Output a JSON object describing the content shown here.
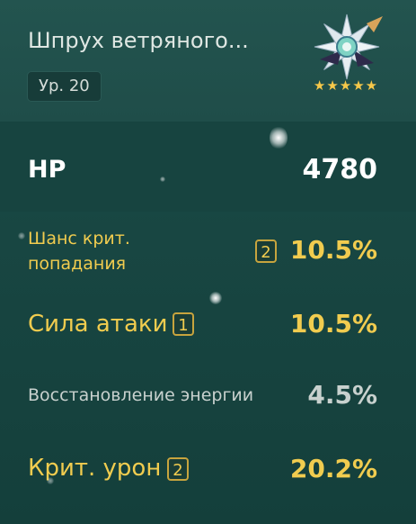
{
  "artifact": {
    "name": "Шпрух ветряного...",
    "level": "Ур. 20",
    "stars": "★★★★★",
    "rarity": 5
  },
  "main_stat": {
    "label": "HP",
    "value": "4780"
  },
  "substats": [
    {
      "label_line1": "Шанс крит.",
      "label_line2": "попадания",
      "rolls": "2",
      "value": "10.5%"
    },
    {
      "label": "Сила атаки",
      "rolls": "1",
      "value": "10.5%"
    },
    {
      "label": "Восстановление энергии",
      "value": "4.5%"
    },
    {
      "label": "Крит. урон",
      "rolls": "2",
      "value": "20.2%"
    }
  ],
  "colors": {
    "highlight": "#f1cc4f",
    "neutral": "#c8d1ce",
    "background": "#184642"
  }
}
